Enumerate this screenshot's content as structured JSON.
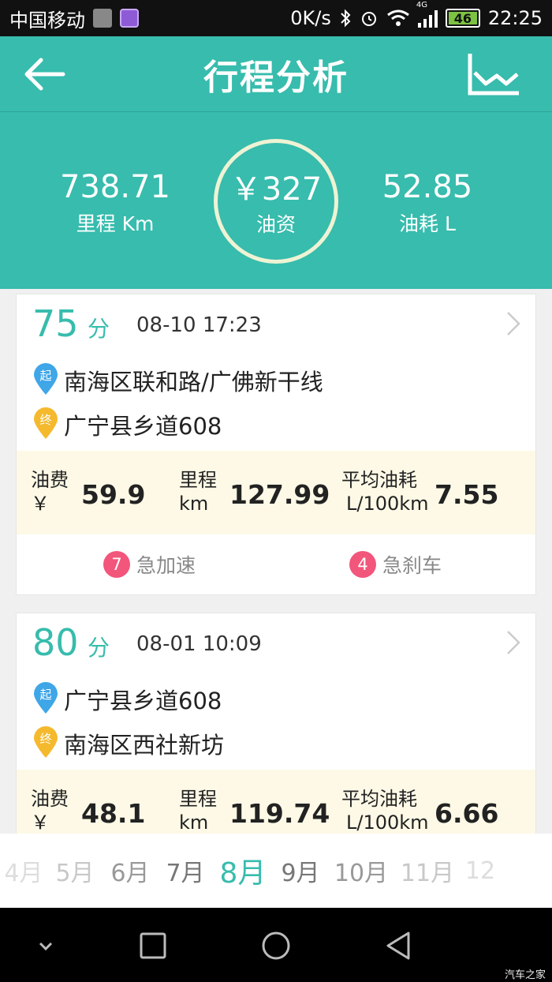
{
  "status_bar": {
    "carrier": "中国移动",
    "speed": "0K/s",
    "network": "4G",
    "battery": "46",
    "time": "22:25"
  },
  "app_bar": {
    "title": "行程分析",
    "back_icon": "back-arrow-icon",
    "chart_icon": "line-chart-icon"
  },
  "summary": {
    "mileage_value": "738.71",
    "mileage_label": "里程 Km",
    "fuel_cost_value": "￥327",
    "fuel_cost_label": "油资",
    "fuel_used_value": "52.85",
    "fuel_used_label": "油耗 L",
    "ring_color": "#eef3d4"
  },
  "trips": [
    {
      "score": "75",
      "score_unit": "分",
      "datetime": "08-10 17:23",
      "start_tag": "起",
      "start": "南海区联和路/广佛新干线",
      "end_tag": "终",
      "end": "广宁县乡道608",
      "fee_label": "油费",
      "fee_unit": "￥",
      "fee": "59.9",
      "distance_label": "里程",
      "distance_unit": "km",
      "distance": "127.99",
      "avg_label": "平均油耗",
      "avg_unit": "L/100km",
      "avg": "7.55",
      "accel_count": "7",
      "accel_label": "急加速",
      "brake_count": "4",
      "brake_label": "急刹车"
    },
    {
      "score": "80",
      "score_unit": "分",
      "datetime": "08-01 10:09",
      "start_tag": "起",
      "start": "广宁县乡道608",
      "end_tag": "终",
      "end": "南海区西社新坊",
      "fee_label": "油费",
      "fee_unit": "￥",
      "fee": "48.1",
      "distance_label": "里程",
      "distance_unit": "km",
      "distance": "119.74",
      "avg_label": "平均油耗",
      "avg_unit": "L/100km",
      "avg": "6.66"
    }
  ],
  "months": [
    "4月",
    "5月",
    "6月",
    "7月",
    "8月",
    "9月",
    "10月",
    "11月",
    "12"
  ],
  "selected_month": "8月",
  "colors": {
    "accent": "#37bcad",
    "start_pin": "#3fa6e8",
    "end_pin": "#f5b92d",
    "badge": "#f2567b",
    "strip": "#fdf9e6"
  },
  "watermark": "汽车之家"
}
